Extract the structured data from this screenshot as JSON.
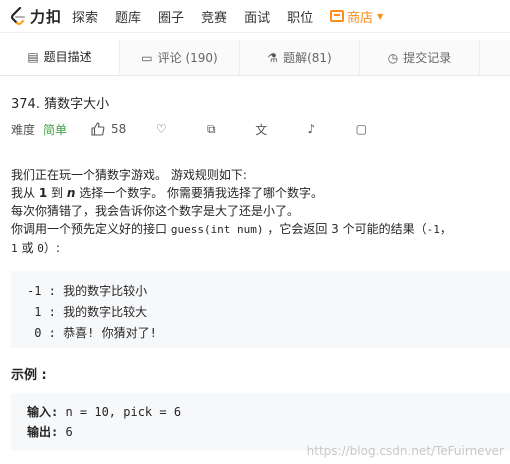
{
  "nav": {
    "logo_text": "力扣",
    "items": [
      "探索",
      "题库",
      "圈子",
      "竞赛",
      "面试",
      "职位"
    ],
    "store_label": "商店",
    "store_color": "#ff8d1a"
  },
  "tabs": [
    {
      "icon": "description-icon",
      "label": "题目描述",
      "active": true
    },
    {
      "icon": "comment-icon",
      "label": "评论 (190)",
      "active": false
    },
    {
      "icon": "flask-icon",
      "label": "题解(81)",
      "active": false
    },
    {
      "icon": "clock-icon",
      "label": "提交记录",
      "active": false
    }
  ],
  "problem": {
    "title": "374. 猜数字大小",
    "difficulty_label": "难度",
    "difficulty": "简单",
    "difficulty_color": "#43a047",
    "likes": "58"
  },
  "description": {
    "line1": "我们正在玩一个猜数字游戏。 游戏规则如下:",
    "line2_a": "我从 ",
    "line2_b": "1",
    "line2_c": " 到 ",
    "line2_d": "n",
    "line2_e": " 选择一个数字。 你需要猜我选择了哪个数字。",
    "line3": "每次你猜错了，我会告诉你这个数字是大了还是小了。",
    "line4_a": "你调用一个预先定义好的接口 ",
    "line4_code": "guess(int num)",
    "line4_b": " ，它会返回 3 个可能的结果（",
    "line4_code2": "-1",
    "line4_c": "，",
    "line5_code": "1",
    "line5_a": " 或 ",
    "line5_code2": "0",
    "line5_b": "）:"
  },
  "codeblock": {
    "line1": "-1 : 我的数字比较小",
    "line2": " 1 : 我的数字比较大",
    "line3": " 0 : 恭喜! 你猜对了!"
  },
  "example": {
    "heading": "示例 :",
    "input_label": "输入:",
    "input_value": " n = 10, pick = 6",
    "output_label": "输出:",
    "output_value": " 6"
  },
  "watermark": "https://blog.csdn.net/TeFuirnever"
}
